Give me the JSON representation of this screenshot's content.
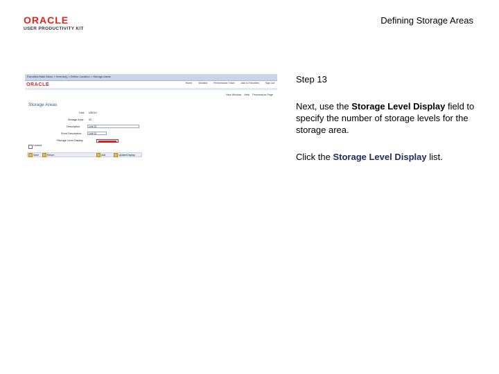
{
  "header": {
    "logo_brand": "ORACLE",
    "logo_product": "USER PRODUCTIVITY KIT",
    "title": "Defining Storage Areas"
  },
  "screenshot": {
    "breadcrumbs": "Favorites   Main Menu  >  Inventory  >  Define Location  >  Storage Areas",
    "brand": "ORACLE",
    "top_links": [
      "Home",
      "Worklist",
      "Performance Trace",
      "Add to Favorites",
      "Sign out"
    ],
    "page_links": [
      "New Window",
      "Help",
      "Personalize Page"
    ],
    "heading": "Storage Areas",
    "fields": {
      "unit_label": "Unit:",
      "unit_value": "US010",
      "storage_area_label": "Storage Area:",
      "storage_area_value": "02",
      "description_label": "Description:",
      "description_value": "Unit 02",
      "short_desc_label": "Short Description:",
      "short_desc_value": "Unit 02",
      "storage_level_label": "*Storage Level Display:"
    },
    "checkbox_label": "Locked",
    "buttons": [
      "Save",
      "Return",
      "Add",
      "Update/Display"
    ]
  },
  "instructions": {
    "step": "Step 13",
    "para1_before": "Next, use the ",
    "para1_bold": "Storage Level Display",
    "para1_after": " field to specify the number of storage levels for the storage area.",
    "para2_before": "Click the ",
    "para2_bold": "Storage Level Display",
    "para2_after": " list."
  }
}
